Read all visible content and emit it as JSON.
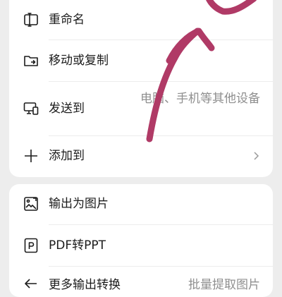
{
  "menu_group_1": {
    "items": [
      {
        "label": "重命名",
        "icon": "rename-icon"
      },
      {
        "label": "移动或复制",
        "icon": "folder-move-icon"
      },
      {
        "label": "发送到",
        "icon": "devices-icon",
        "hint": "电脑、手机等其他设备"
      },
      {
        "label": "添加到",
        "icon": "plus-icon",
        "has_arrow": true
      }
    ]
  },
  "menu_group_2": {
    "items": [
      {
        "label": "输出为图片",
        "icon": "export-image-icon"
      },
      {
        "label": "PDF转PPT",
        "icon": "pdf-to-ppt-icon"
      },
      {
        "label": "更多输出转换",
        "icon": "more-convert-icon",
        "hint": "批量提取图片"
      }
    ]
  },
  "colors": {
    "background": "#ededed",
    "card": "#ffffff",
    "text": "#1c1c1c",
    "hint": "#8f8f8f",
    "annotation_stroke": "#b03a66"
  }
}
